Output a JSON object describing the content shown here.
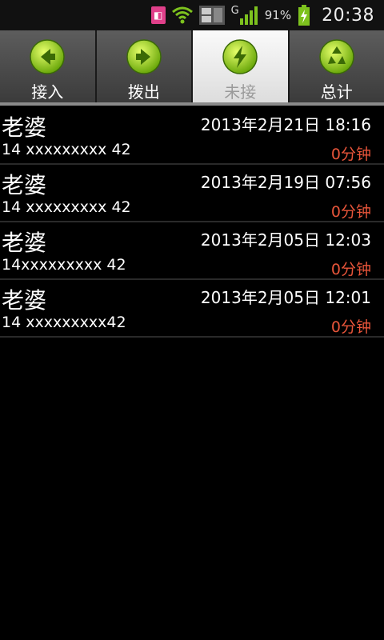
{
  "status_bar": {
    "battery_percent": "91%",
    "time": "20:38",
    "network": "G"
  },
  "tabs": [
    {
      "label": "接入",
      "icon": "arrow-left-icon",
      "active": false
    },
    {
      "label": "拨出",
      "icon": "arrow-right-icon",
      "active": false
    },
    {
      "label": "未接",
      "icon": "lightning-icon",
      "active": true
    },
    {
      "label": "总计",
      "icon": "recycle-icon",
      "active": false
    }
  ],
  "calls": [
    {
      "name": "老婆",
      "number": "14 xxxxxxxxx 42",
      "time": "2013年2月21日 18:16",
      "duration": "0分钟"
    },
    {
      "name": "老婆",
      "number": "14 xxxxxxxxx 42",
      "time": "2013年2月19日 07:56",
      "duration": "0分钟"
    },
    {
      "name": "老婆",
      "number": "14xxxxxxxxx 42",
      "time": "2013年2月05日 12:03",
      "duration": "0分钟"
    },
    {
      "name": "老婆",
      "number": "14 xxxxxxxxx42",
      "time": "2013年2月05日 12:01",
      "duration": "0分钟"
    }
  ],
  "colors": {
    "accent_green": "#9fd21b",
    "duration_red": "#e8553a"
  }
}
